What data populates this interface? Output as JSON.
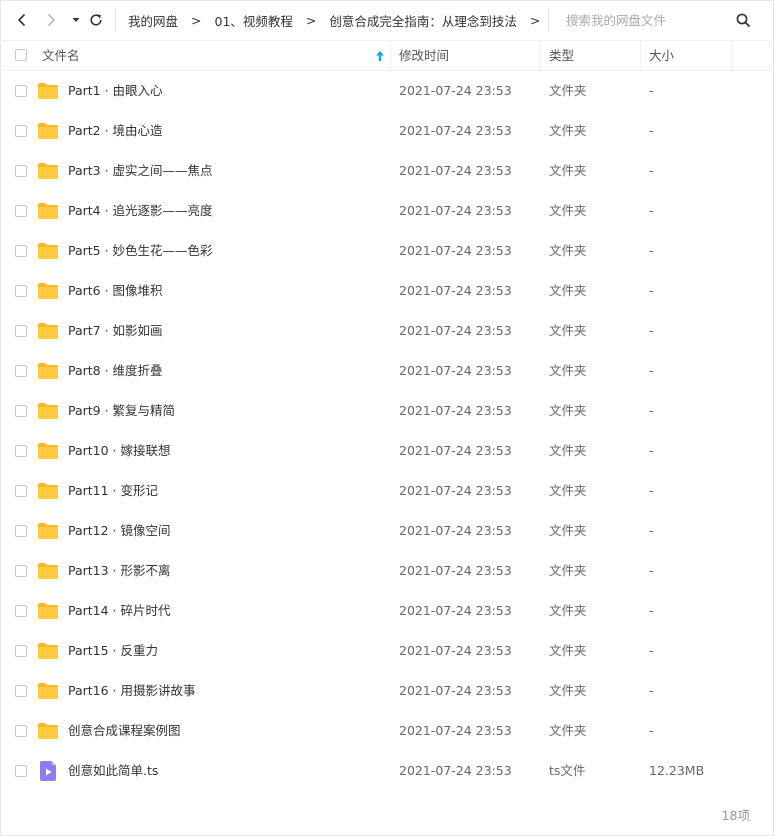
{
  "breadcrumb": {
    "items": [
      "我的网盘",
      "01、视频教程",
      "创意合成完全指南：从理念到技法"
    ],
    "separator": ">"
  },
  "search": {
    "placeholder": "搜索我的网盘文件"
  },
  "table": {
    "headers": {
      "name": "文件名",
      "modified": "修改时间",
      "type": "类型",
      "size": "大小"
    },
    "sort": {
      "column": "name",
      "direction": "ascending"
    },
    "rows": [
      {
        "icon": "folder-icon",
        "name": "Part1 · 由眼入心",
        "modified": "2021-07-24 23:53",
        "type": "文件夹",
        "size": "-"
      },
      {
        "icon": "folder-icon",
        "name": "Part2 · 境由心造",
        "modified": "2021-07-24 23:53",
        "type": "文件夹",
        "size": "-"
      },
      {
        "icon": "folder-icon",
        "name": "Part3 · 虚实之间——焦点",
        "modified": "2021-07-24 23:53",
        "type": "文件夹",
        "size": "-"
      },
      {
        "icon": "folder-icon",
        "name": "Part4 · 追光逐影——亮度",
        "modified": "2021-07-24 23:53",
        "type": "文件夹",
        "size": "-"
      },
      {
        "icon": "folder-icon",
        "name": "Part5 · 妙色生花——色彩",
        "modified": "2021-07-24 23:53",
        "type": "文件夹",
        "size": "-"
      },
      {
        "icon": "folder-icon",
        "name": "Part6 · 图像堆积",
        "modified": "2021-07-24 23:53",
        "type": "文件夹",
        "size": "-"
      },
      {
        "icon": "folder-icon",
        "name": "Part7 · 如影如画",
        "modified": "2021-07-24 23:53",
        "type": "文件夹",
        "size": "-"
      },
      {
        "icon": "folder-icon",
        "name": "Part8 · 维度折叠",
        "modified": "2021-07-24 23:53",
        "type": "文件夹",
        "size": "-"
      },
      {
        "icon": "folder-icon",
        "name": "Part9 · 繁复与精简",
        "modified": "2021-07-24 23:53",
        "type": "文件夹",
        "size": "-"
      },
      {
        "icon": "folder-icon",
        "name": "Part10 · 嫁接联想",
        "modified": "2021-07-24 23:53",
        "type": "文件夹",
        "size": "-"
      },
      {
        "icon": "folder-icon",
        "name": "Part11 · 变形记",
        "modified": "2021-07-24 23:53",
        "type": "文件夹",
        "size": "-"
      },
      {
        "icon": "folder-icon",
        "name": "Part12 · 镜像空间",
        "modified": "2021-07-24 23:53",
        "type": "文件夹",
        "size": "-"
      },
      {
        "icon": "folder-icon",
        "name": "Part13 · 形影不离",
        "modified": "2021-07-24 23:53",
        "type": "文件夹",
        "size": "-"
      },
      {
        "icon": "folder-icon",
        "name": "Part14 · 碎片时代",
        "modified": "2021-07-24 23:53",
        "type": "文件夹",
        "size": "-"
      },
      {
        "icon": "folder-icon",
        "name": "Part15 · 反重力",
        "modified": "2021-07-24 23:53",
        "type": "文件夹",
        "size": "-"
      },
      {
        "icon": "folder-icon",
        "name": "Part16 · 用摄影讲故事",
        "modified": "2021-07-24 23:53",
        "type": "文件夹",
        "size": "-"
      },
      {
        "icon": "folder-icon",
        "name": "创意合成课程案例图",
        "modified": "2021-07-24 23:53",
        "type": "文件夹",
        "size": "-"
      },
      {
        "icon": "video-file-icon",
        "name": "创意如此简单.ts",
        "modified": "2021-07-24 23:53",
        "type": "ts文件",
        "size": "12.23MB"
      }
    ]
  },
  "footer": {
    "count": "18项"
  },
  "colors": {
    "folder": "#ffc940",
    "folder_tab": "#f5b72e",
    "video": "#8c7cf0",
    "sort_arrow": "#06a7ff"
  }
}
